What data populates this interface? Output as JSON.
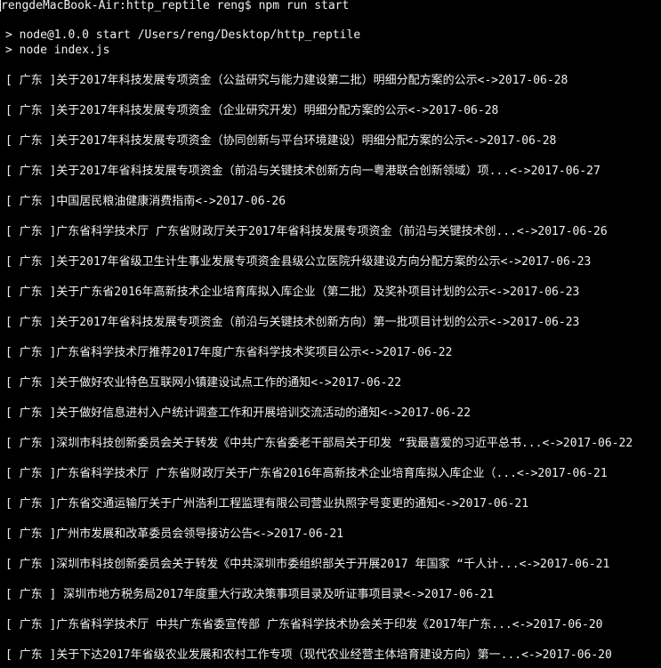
{
  "terminal": {
    "prompt": "rengdeMacBook-Air:http_reptile reng$ npm run start",
    "npm_start_line": "> node@1.0.0 start /Users/reng/Desktop/http_reptile",
    "node_index_line": "> node index.js"
  },
  "output": {
    "items": [
      "[ 广东 ]关于2017年科技发展专项资金（公益研究与能力建设第二批）明细分配方案的公示<->2017-06-28",
      "[ 广东 ]关于2017年科技发展专项资金（企业研究开发）明细分配方案的公示<->2017-06-28",
      "[ 广东 ]关于2017年科技发展专项资金（协同创新与平台环境建设）明细分配方案的公示<->2017-06-28",
      "[ 广东 ]关于2017年省科技发展专项资金（前沿与关键技术创新方向一粤港联合创新领域）项...<->2017-06-27",
      "[ 广东 ]中国居民粮油健康消费指南<->2017-06-26",
      "[ 广东 ]广东省科学技术厅 广东省财政厅关于2017年省科技发展专项资金（前沿与关键技术创...<->2017-06-26",
      "[ 广东 ]关于2017年省级卫生计生事业发展专项资金县级公立医院升级建设方向分配方案的公示<->2017-06-23",
      "[ 广东 ]关于广东省2016年高新技术企业培育库拟入库企业（第二批）及奖补项目计划的公示<->2017-06-23",
      "[ 广东 ]关于2017年省科技发展专项资金（前沿与关键技术创新方向）第一批项目计划的公示<->2017-06-23",
      "[ 广东 ]广东省科学技术厅推荐2017年度广东省科学技术奖项目公示<->2017-06-22",
      "[ 广东 ]关于做好农业特色互联网小镇建设试点工作的通知<->2017-06-22",
      "[ 广东 ]关于做好信息进村入户统计调查工作和开展培训交流活动的通知<->2017-06-22",
      "[ 广东 ]深圳市科技创新委员会关于转发《中共广东省委老干部局关于印发 “我最喜爱的习近平总书...<->2017-06-22",
      "[ 广东 ]广东省科学技术厅 广东省财政厅关于广东省2016年高新技术企业培育库拟入库企业（...<->2017-06-21",
      "[ 广东 ]广东省交通运输厅关于广州浩利工程监理有限公司营业执照字号变更的通知<->2017-06-21",
      "[ 广东 ]广州市发展和改革委员会领导接访公告<->2017-06-21",
      "[ 广东 ]深圳市科技创新委员会关于转发《中共深圳市委组织部关于开展2017 年国家 “千人计...<->2017-06-21",
      "[ 广东 ] 深圳市地方税务局2017年度重大行政决策事项目录及听证事项目录<->2017-06-21",
      "[ 广东 ]广东省科学技术厅 中共广东省委宣传部 广东省科学技术协会关于印发《2017年广东...<->2017-06-20",
      "[ 广东 ]关于下达2017年省级农业发展和农村工作专项（现代农业经营主体培育建设方向）第一...<->2017-06-20"
    ]
  },
  "colors": {
    "background": "#000000",
    "text": "#f0f0f0"
  }
}
